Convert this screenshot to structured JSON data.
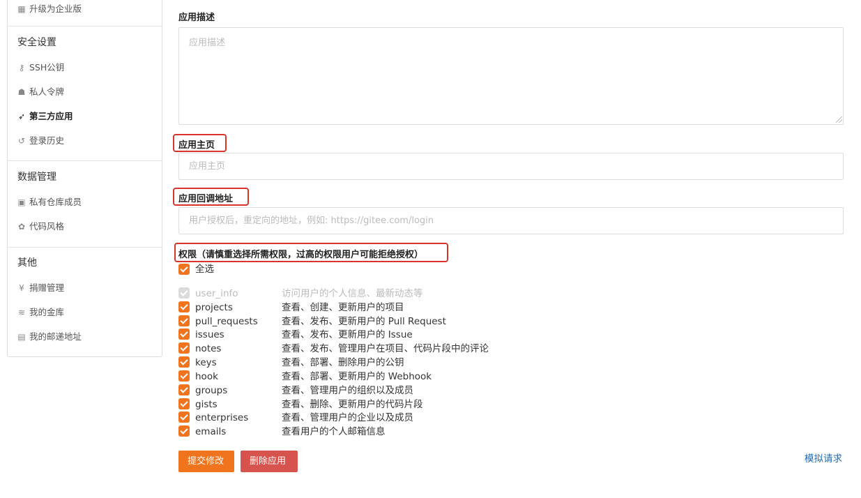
{
  "sidebar": {
    "top_item": {
      "icon": "building-icon",
      "label": "升级为企业版"
    },
    "sections": [
      {
        "title": "安全设置",
        "items": [
          {
            "icon": "key-icon",
            "label": "SSH公钥",
            "active": false
          },
          {
            "icon": "user-secret-icon",
            "label": "私人令牌",
            "active": false
          },
          {
            "icon": "rocket-icon",
            "label": "第三方应用",
            "active": true
          },
          {
            "icon": "history-icon",
            "label": "登录历史",
            "active": false
          }
        ]
      },
      {
        "title": "数据管理",
        "items": [
          {
            "icon": "id-badge-icon",
            "label": "私有仓库成员"
          },
          {
            "icon": "palette-icon",
            "label": "代码风格"
          }
        ]
      },
      {
        "title": "其他",
        "items": [
          {
            "icon": "yen-icon",
            "label": "捐赠管理"
          },
          {
            "icon": "coins-icon",
            "label": "我的金库"
          },
          {
            "icon": "address-card-icon",
            "label": "我的邮递地址"
          }
        ]
      }
    ]
  },
  "form": {
    "description": {
      "label": "应用描述",
      "placeholder": "应用描述",
      "value": ""
    },
    "homepage": {
      "label": "应用主页",
      "placeholder": "应用主页",
      "value": ""
    },
    "callback": {
      "label": "应用回调地址",
      "placeholder": "用户授权后，重定向的地址，例如: https://gitee.com/login",
      "value": ""
    },
    "permissions": {
      "label": "权限（请慎重选择所需权限，过高的权限用户可能拒绝授权）",
      "select_all": "全选",
      "items": [
        {
          "name": "user_info",
          "desc": "访问用户的个人信息、最新动态等",
          "checked": true,
          "disabled": true
        },
        {
          "name": "projects",
          "desc": "查看、创建、更新用户的项目",
          "checked": true,
          "disabled": false
        },
        {
          "name": "pull_requests",
          "desc": "查看、发布、更新用户的 Pull Request",
          "checked": true,
          "disabled": false
        },
        {
          "name": "issues",
          "desc": "查看、发布、更新用户的 Issue",
          "checked": true,
          "disabled": false
        },
        {
          "name": "notes",
          "desc": "查看、发布、管理用户在项目、代码片段中的评论",
          "checked": true,
          "disabled": false
        },
        {
          "name": "keys",
          "desc": "查看、部署、删除用户的公钥",
          "checked": true,
          "disabled": false
        },
        {
          "name": "hook",
          "desc": "查看、部署、更新用户的 Webhook",
          "checked": true,
          "disabled": false
        },
        {
          "name": "groups",
          "desc": "查看、管理用户的组织以及成员",
          "checked": true,
          "disabled": false
        },
        {
          "name": "gists",
          "desc": "查看、删除、更新用户的代码片段",
          "checked": true,
          "disabled": false
        },
        {
          "name": "enterprises",
          "desc": "查看、管理用户的企业以及成员",
          "checked": true,
          "disabled": false
        },
        {
          "name": "emails",
          "desc": "查看用户的个人邮箱信息",
          "checked": true,
          "disabled": false
        }
      ]
    }
  },
  "actions": {
    "submit": "提交修改",
    "delete": "删除应用",
    "simulate": "模拟请求"
  },
  "colors": {
    "accent": "#f0731d",
    "danger": "#d6544d",
    "highlight": "#d9342b",
    "link": "#1e6bb8"
  }
}
